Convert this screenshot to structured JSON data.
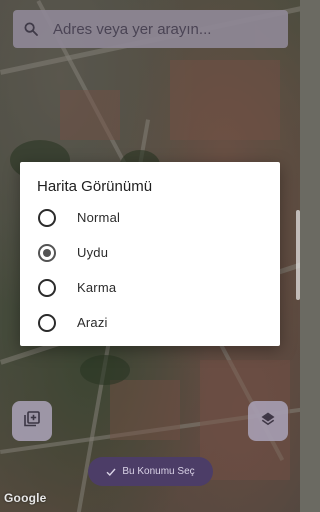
{
  "search": {
    "placeholder": "Adres veya yer arayın...",
    "icon": "search-icon"
  },
  "dialog": {
    "title": "Harita Görünümü",
    "options": [
      {
        "label": "Normal",
        "selected": false
      },
      {
        "label": "Uydu",
        "selected": true
      },
      {
        "label": "Karma",
        "selected": false
      },
      {
        "label": "Arazi",
        "selected": false
      }
    ]
  },
  "buttons": {
    "add_photo_icon": "add-photo-icon",
    "layers_icon": "layers-icon",
    "confirm_label": "Bu Konumu Seç"
  },
  "map": {
    "attribution": "Google"
  },
  "colors": {
    "accent": "#4c3d67",
    "fab": "#a79fb3",
    "search_bg": "#8f8896"
  }
}
